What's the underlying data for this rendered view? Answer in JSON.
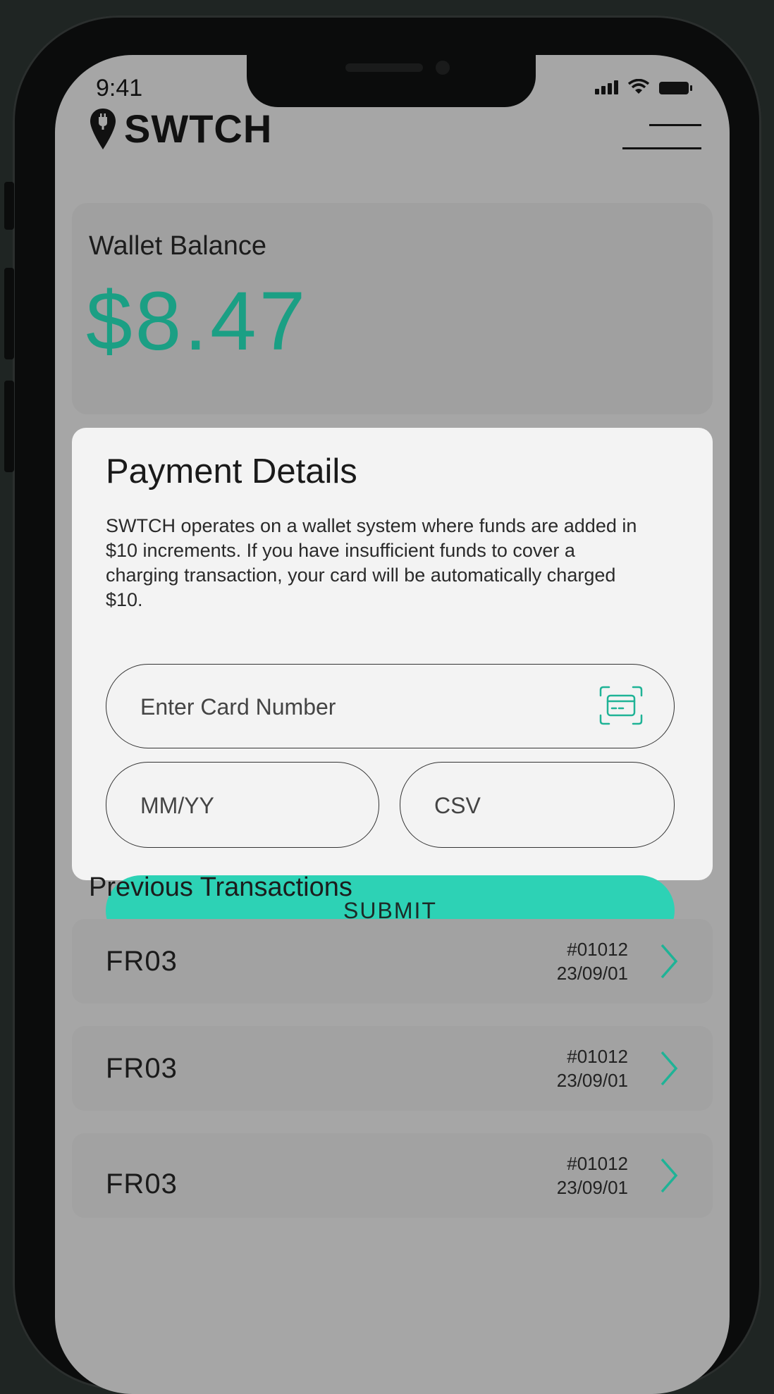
{
  "status_bar": {
    "time": "9:41"
  },
  "header": {
    "brand": "SWTCH"
  },
  "wallet": {
    "label": "Wallet Balance",
    "amount": "$8.47"
  },
  "payment_modal": {
    "title": "Payment Details",
    "description": "SWTCH operates on a wallet system where funds are added in $10 increments. If you have insufficient funds to cover a charging transaction, your card will be automatically charged $10.",
    "card_number_placeholder": "Enter Card Number",
    "expiry_placeholder": "MM/YY",
    "csv_placeholder": "CSV",
    "submit_label": "SUBMIT"
  },
  "transactions": {
    "heading": "Previous Transactions",
    "items": [
      {
        "name": "FR03",
        "id": "#01012",
        "date": "23/09/01"
      },
      {
        "name": "FR03",
        "id": "#01012",
        "date": "23/09/01"
      },
      {
        "name": "FR03",
        "id": "#01012",
        "date": "23/09/01"
      }
    ]
  },
  "colors": {
    "accent": "#2dd2b5",
    "amount": "#1b9f84",
    "screen_dim": "#a6a6a6",
    "modal": "#f3f3f3"
  }
}
